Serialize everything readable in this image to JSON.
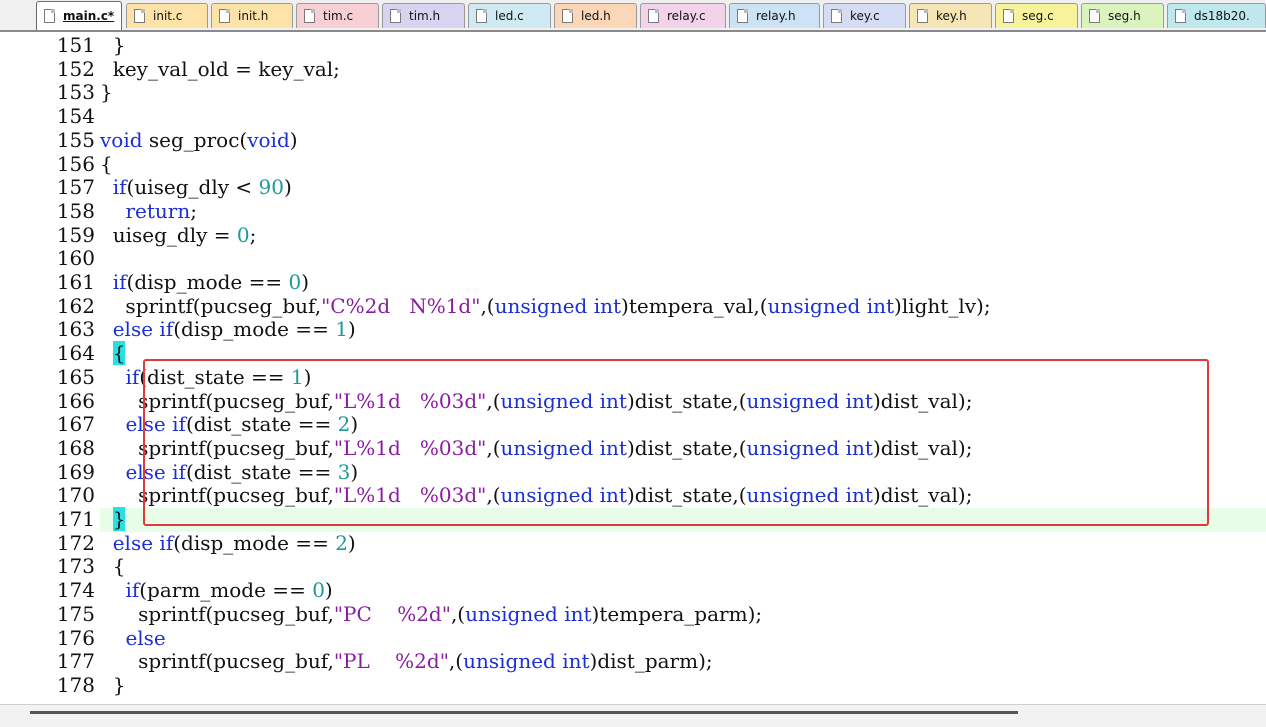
{
  "tabs": [
    {
      "label": "main.c*",
      "color": "#ffffff",
      "active": true
    },
    {
      "label": "init.c",
      "color": "#fde3a7",
      "active": false
    },
    {
      "label": "init.h",
      "color": "#fde3a7",
      "active": false
    },
    {
      "label": "tim.c",
      "color": "#f9cfd6",
      "active": false
    },
    {
      "label": "tim.h",
      "color": "#d9d3f2",
      "active": false
    },
    {
      "label": "led.c",
      "color": "#cfeaf2",
      "active": false
    },
    {
      "label": "led.h",
      "color": "#fbd7b8",
      "active": false
    },
    {
      "label": "relay.c",
      "color": "#f2d3e9",
      "active": false
    },
    {
      "label": "relay.h",
      "color": "#cde3f5",
      "active": false
    },
    {
      "label": "key.c",
      "color": "#d6dcf4",
      "active": false
    },
    {
      "label": "key.h",
      "color": "#f6e6b5",
      "active": false
    },
    {
      "label": "seg.c",
      "color": "#f7f39a",
      "active": false
    },
    {
      "label": "seg.h",
      "color": "#dbf3bd",
      "active": false
    },
    {
      "label": "ds18b20.",
      "color": "#bfe8ee",
      "active": false
    }
  ],
  "editor": {
    "current_line": 171,
    "lines": [
      {
        "n": 151,
        "code": "  }"
      },
      {
        "n": 152,
        "code": "  key_val_old = key_val;"
      },
      {
        "n": 153,
        "code": "}"
      },
      {
        "n": 154,
        "code": ""
      },
      {
        "n": 155,
        "code": "void seg_proc(void)"
      },
      {
        "n": 156,
        "code": "{"
      },
      {
        "n": 157,
        "code": "  if(uiseg_dly < 90)"
      },
      {
        "n": 158,
        "code": "    return;"
      },
      {
        "n": 159,
        "code": "  uiseg_dly = 0;"
      },
      {
        "n": 160,
        "code": ""
      },
      {
        "n": 161,
        "code": "  if(disp_mode == 0)"
      },
      {
        "n": 162,
        "code": "    sprintf(pucseg_buf,\"C%2d   N%1d\",(unsigned int)tempera_val,(unsigned int)light_lv);"
      },
      {
        "n": 163,
        "code": "  else if(disp_mode == 1)"
      },
      {
        "n": 164,
        "code": "  {"
      },
      {
        "n": 165,
        "code": "    if(dist_state == 1)"
      },
      {
        "n": 166,
        "code": "      sprintf(pucseg_buf,\"L%1d   %03d\",(unsigned int)dist_state,(unsigned int)dist_val);"
      },
      {
        "n": 167,
        "code": "    else if(dist_state == 2)"
      },
      {
        "n": 168,
        "code": "      sprintf(pucseg_buf,\"L%1d   %03d\",(unsigned int)dist_state,(unsigned int)dist_val);"
      },
      {
        "n": 169,
        "code": "    else if(dist_state == 3)"
      },
      {
        "n": 170,
        "code": "      sprintf(pucseg_buf,\"L%1d   %03d\",(unsigned int)dist_state,(unsigned int)dist_val);"
      },
      {
        "n": 171,
        "code": "  }"
      },
      {
        "n": 172,
        "code": "  else if(disp_mode == 2)"
      },
      {
        "n": 173,
        "code": "  {"
      },
      {
        "n": 174,
        "code": "    if(parm_mode == 0)"
      },
      {
        "n": 175,
        "code": "      sprintf(pucseg_buf,\"PC    %2d\",(unsigned int)tempera_parm);"
      },
      {
        "n": 176,
        "code": "    else"
      },
      {
        "n": 177,
        "code": "      sprintf(pucseg_buf,\"PL    %2d\",(unsigned int)dist_parm);"
      },
      {
        "n": 178,
        "code": "  }"
      }
    ]
  },
  "colors": {
    "keyword": "#1a2fd6",
    "string": "#8a1ca0",
    "number": "#1a9a9a",
    "current_line_bg": "#e8fde8",
    "brace_match": "#25e1e1",
    "highlight_box": "#e03b3b"
  }
}
